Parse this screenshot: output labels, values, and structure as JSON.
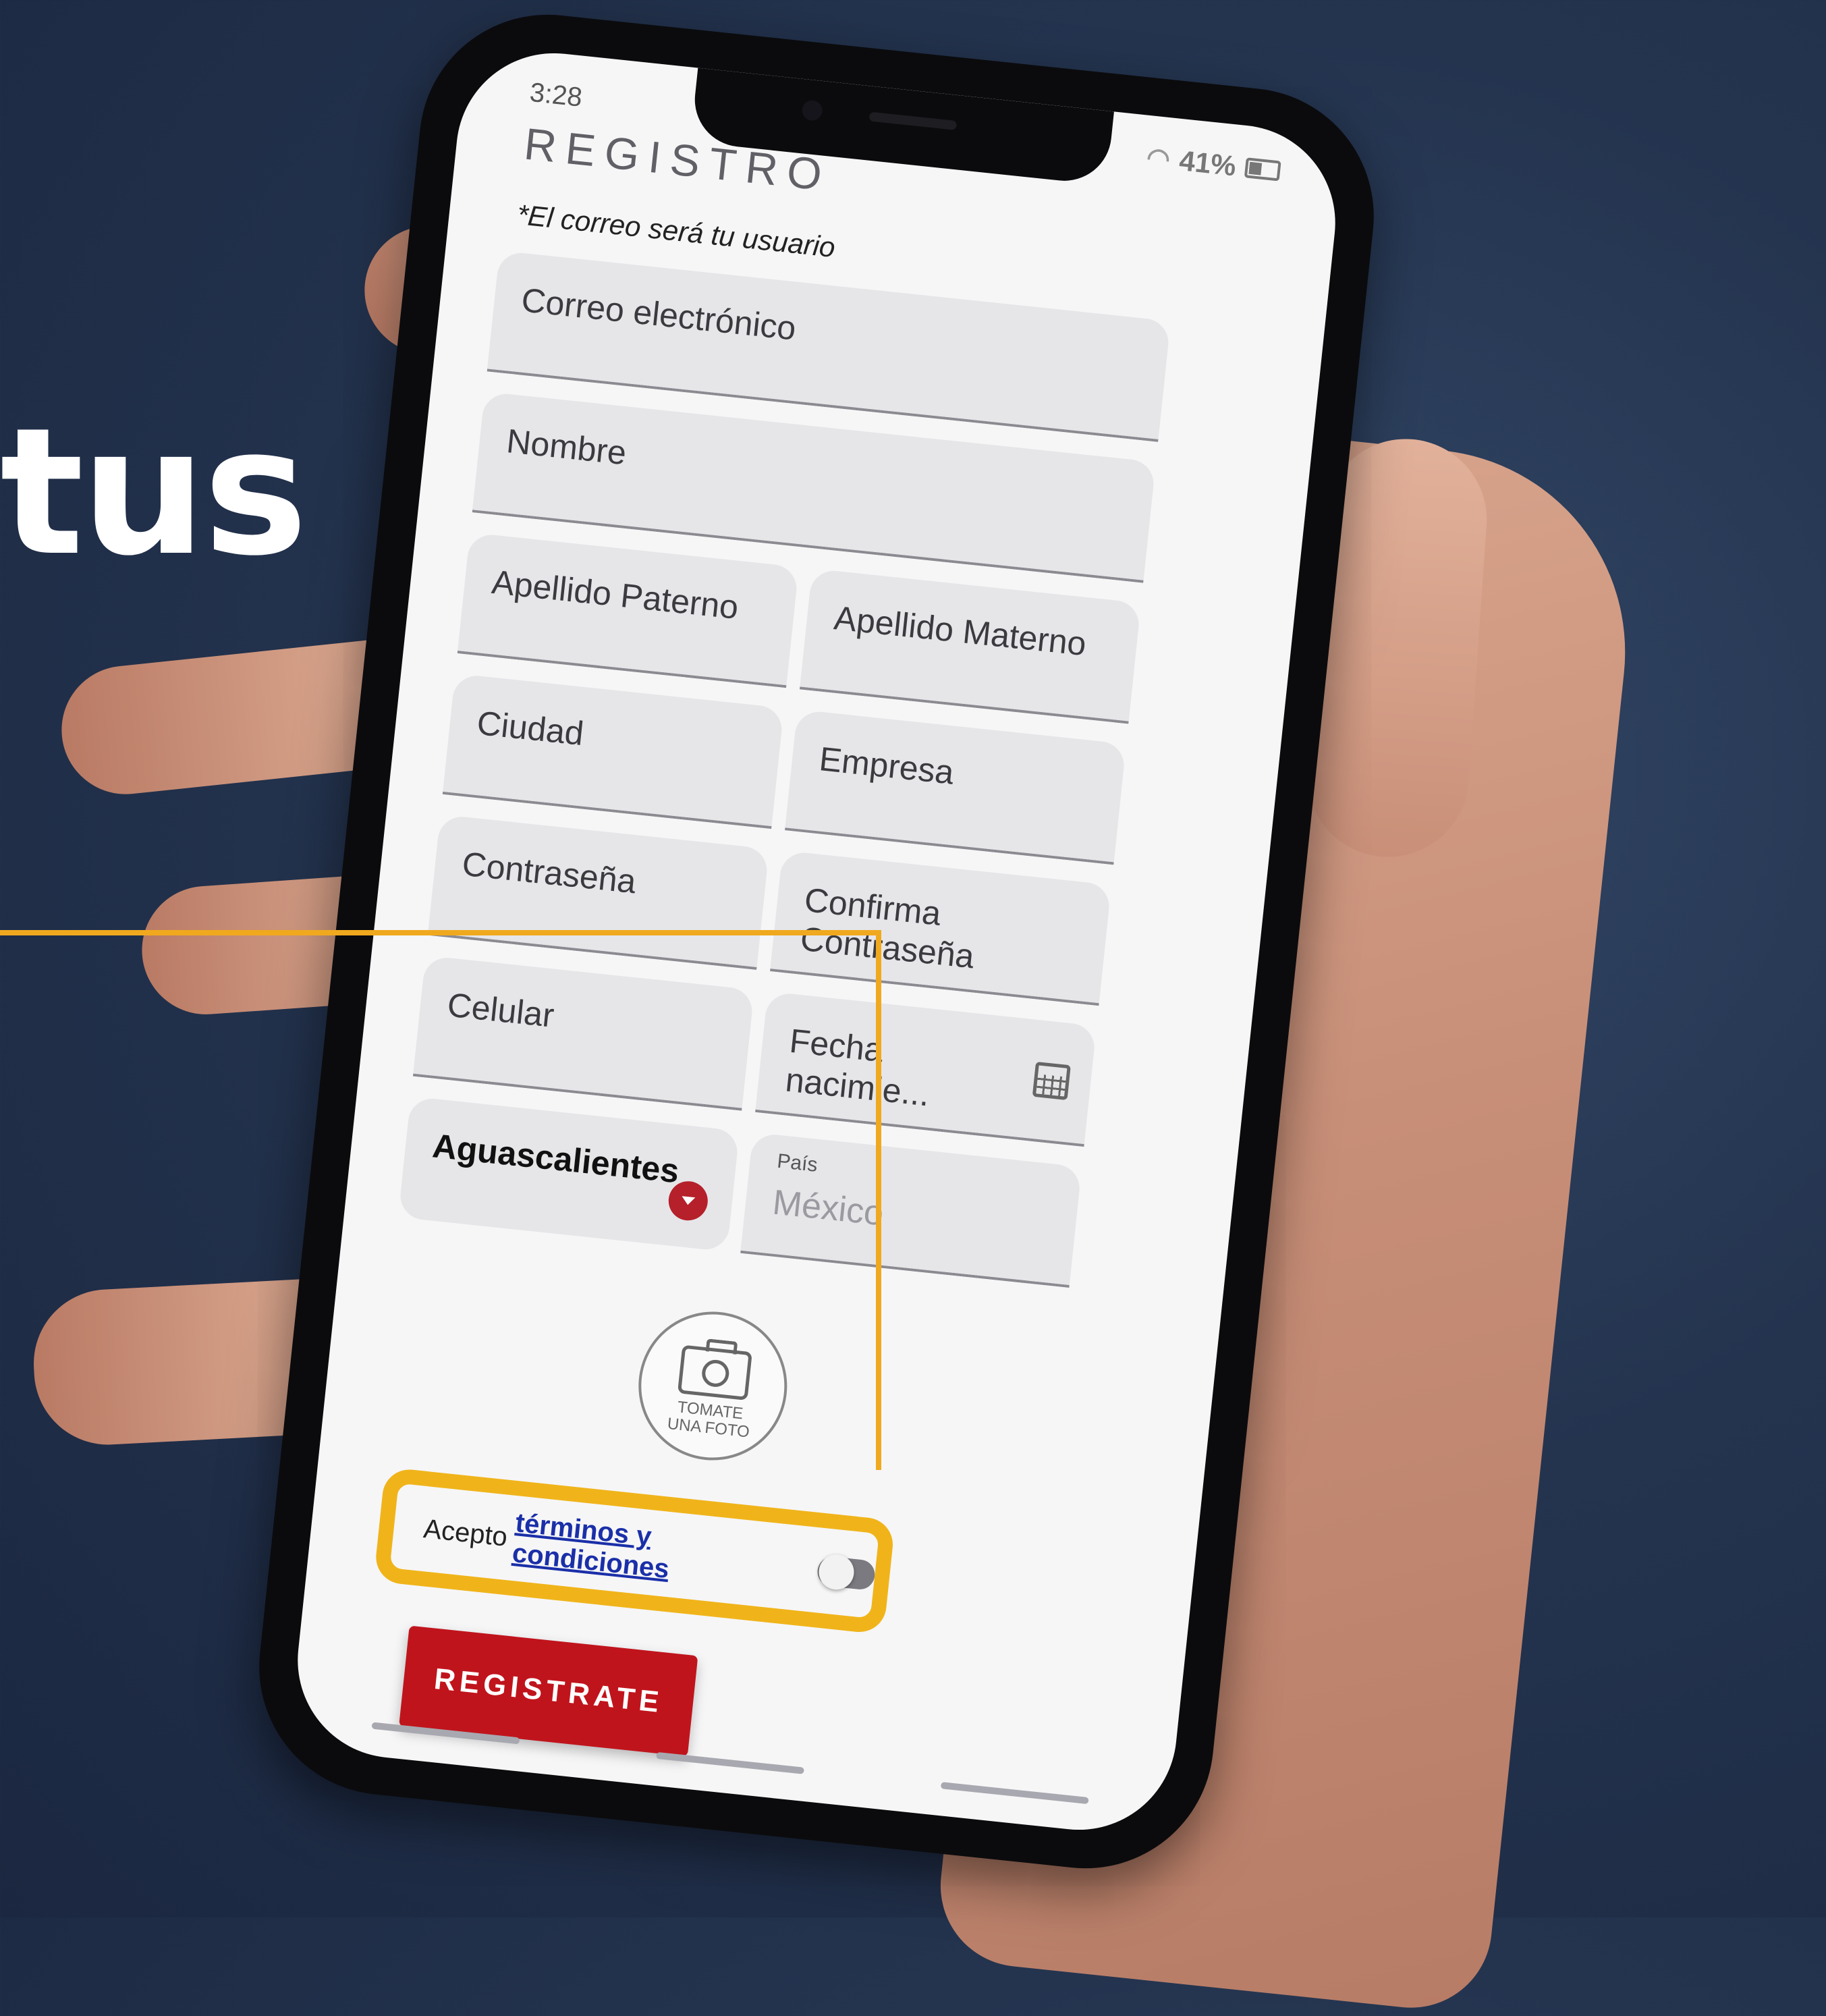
{
  "background": {
    "headline_fragment": "tus",
    "accent_color": "#f0a91e",
    "background_color": "#24344f"
  },
  "status_bar": {
    "time": "3:28",
    "battery": "41%"
  },
  "screen": {
    "title": "REGISTRO",
    "note": "*El correo será tu usuario"
  },
  "form": {
    "email_label": "Correo electrónico",
    "nombre_label": "Nombre",
    "apellido_paterno_label": "Apellido Paterno",
    "apellido_materno_label": "Apellido Materno",
    "ciudad_label": "Ciudad",
    "empresa_label": "Empresa",
    "password_label": "Contraseña",
    "confirm_password_label": "Confirma Contraseña",
    "celular_label": "Celular",
    "fecha_label": "Fecha nacimie...",
    "estado_value": "Aguascalientes",
    "pais_label": "País",
    "pais_value": "México"
  },
  "photo": {
    "label": "TOMATE\nUNA FOTO"
  },
  "terms": {
    "prefix": "Acepto",
    "link_text": "términos y condiciones",
    "toggle_on": false
  },
  "actions": {
    "register_label": "REGISTRATE"
  },
  "colors": {
    "primary_red": "#c0141c",
    "link_blue": "#1a2fa8",
    "highlight": "#f0b41a"
  }
}
